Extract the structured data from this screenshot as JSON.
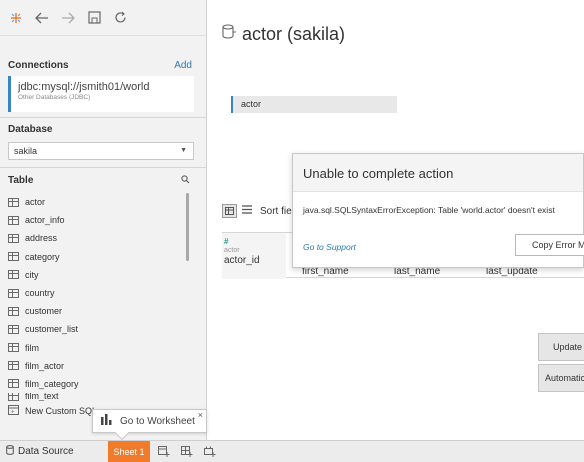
{
  "left": {
    "connections_heading": "Connections",
    "add_label": "Add",
    "connection": {
      "name": "jdbc:mysql://jsmith01/world",
      "subtitle": "Other Databases (JDBC)"
    },
    "database_heading": "Database",
    "database_value": "sakila",
    "table_heading": "Table",
    "tables": [
      "actor",
      "actor_info",
      "address",
      "category",
      "city",
      "country",
      "customer",
      "customer_list",
      "film",
      "film_actor",
      "film_category"
    ],
    "partial_table": "film_text",
    "new_custom_sql": "New Custom SQL"
  },
  "tooltip": {
    "label": "Go to Worksheet",
    "close": "×"
  },
  "tabs": {
    "data_source": "Data Source",
    "sheet": "Sheet 1"
  },
  "right": {
    "title": "actor (sakila)",
    "canvas_table": "actor",
    "sort_label": "Sort fields",
    "columns": {
      "first": {
        "type": "#",
        "source": "actor",
        "name": "actor_id"
      },
      "partial": [
        "first_name",
        "last_name",
        "last_update"
      ]
    },
    "update_button": "Update Now",
    "auto_button": "Automatically Update"
  },
  "dialog": {
    "title": "Unable to complete action",
    "message": "java.sql.SQLSyntaxErrorException: Table 'world.actor' doesn't exist",
    "support_link": "Go to Support",
    "copy_button": "Copy Error Message"
  },
  "colors": {
    "accent_blue": "#3a84c4",
    "sheet_tab": "#f07c2b",
    "link": "#2a7ab0"
  }
}
